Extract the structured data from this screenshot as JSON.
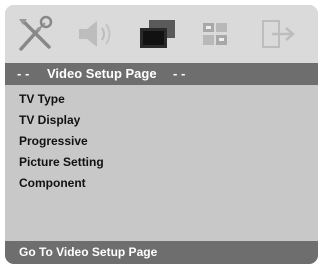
{
  "toolbar": {
    "icons": [
      {
        "name": "general-setup-icon"
      },
      {
        "name": "audio-setup-icon"
      },
      {
        "name": "video-setup-icon"
      },
      {
        "name": "preference-setup-icon"
      },
      {
        "name": "exit-setup-icon"
      }
    ],
    "active_index": 2
  },
  "title": {
    "prefix": "- -",
    "text": "Video Setup Page",
    "suffix": "- -"
  },
  "menu": {
    "items": [
      {
        "label": "TV Type"
      },
      {
        "label": "TV Display"
      },
      {
        "label": "Progressive"
      },
      {
        "label": "Picture Setting"
      },
      {
        "label": "Component"
      }
    ]
  },
  "status": {
    "text": "Go To Video Setup Page"
  },
  "colors": {
    "frame": "#c8c8c8",
    "iconbar": "#dadada",
    "titlebar": "#6e6e6e",
    "text": "#111111",
    "highlight_text": "#ffffff"
  }
}
